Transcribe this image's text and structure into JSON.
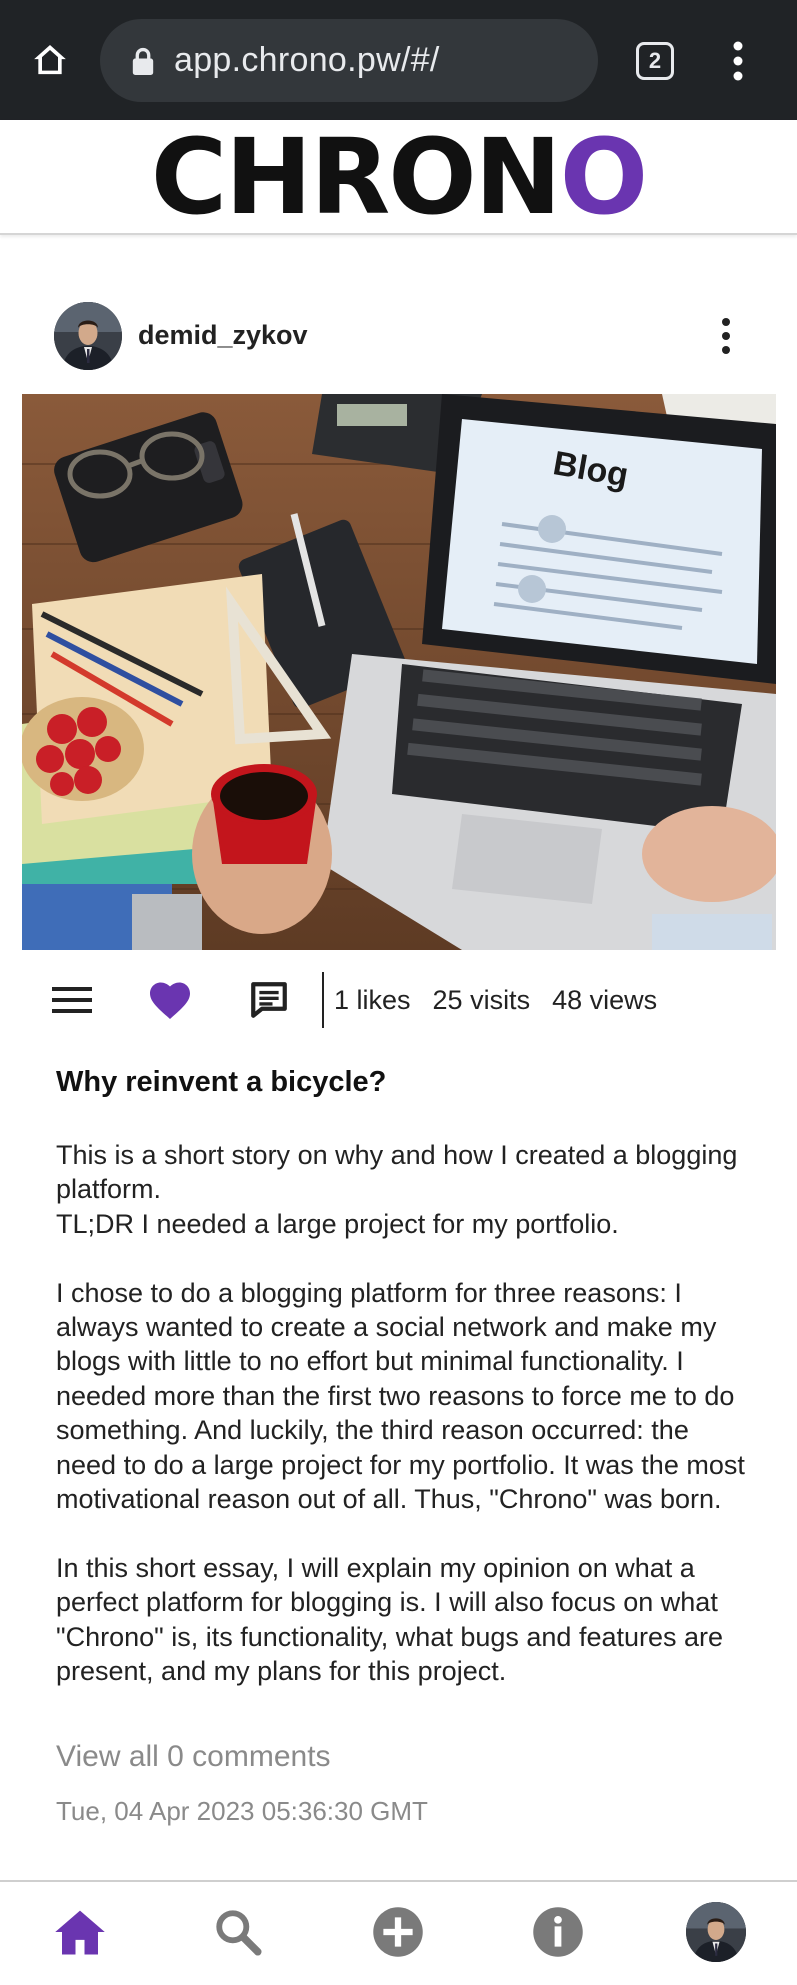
{
  "browser": {
    "url": "app.chrono.pw/#/",
    "tab_count": "2"
  },
  "site": {
    "logo_main": "CHRON",
    "logo_accent": "O",
    "accent_color": "#6a35b0"
  },
  "post": {
    "author": "demid_zykov",
    "image_text": "Blog",
    "stats": {
      "likes": "1 likes",
      "visits": "25 visits",
      "views": "48 views"
    },
    "title": "Why reinvent a bicycle?",
    "paragraphs": [
      "This is a short story on why and how I created a blogging platform.\nTL;DR I needed a large project for my portfolio.",
      "I chose to do a blogging platform for three reasons: I always wanted to create a social network and make my blogs with little to no effort but minimal functionality. I needed more than the first two reasons to force me to do something. And luckily, the third reason occurred: the need to do a large project for my portfolio. It was the most motivational reason out of all. Thus, \"Chrono\" was born.",
      "In this short essay, I will explain my opinion on what a perfect platform for blogging is. I will also focus on what \"Chrono\" is, its functionality, what bugs and features are present, and my plans for this project."
    ],
    "comments_link": "View all 0 comments",
    "timestamp": "Tue, 04 Apr 2023 05:36:30 GMT"
  },
  "icons": {
    "browser": [
      "home-icon",
      "lock-icon",
      "tabs-icon",
      "more-vert-icon"
    ],
    "actions": [
      "hamburger-menu-icon",
      "heart-icon",
      "comment-icon"
    ],
    "nav": [
      "home-icon",
      "search-icon",
      "add-circle-icon",
      "info-icon",
      "profile-avatar"
    ]
  }
}
